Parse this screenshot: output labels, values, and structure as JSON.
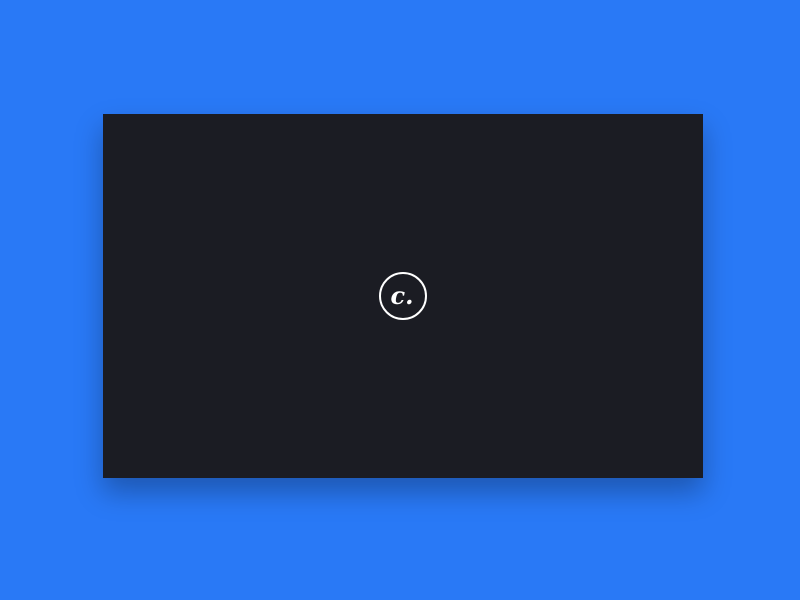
{
  "colors": {
    "background": "#2979f6",
    "window_background": "#1b1c23",
    "logo_stroke": "#ffffff"
  },
  "logo": {
    "icon": "c-dot-circle-logo-icon",
    "letter": "c."
  }
}
